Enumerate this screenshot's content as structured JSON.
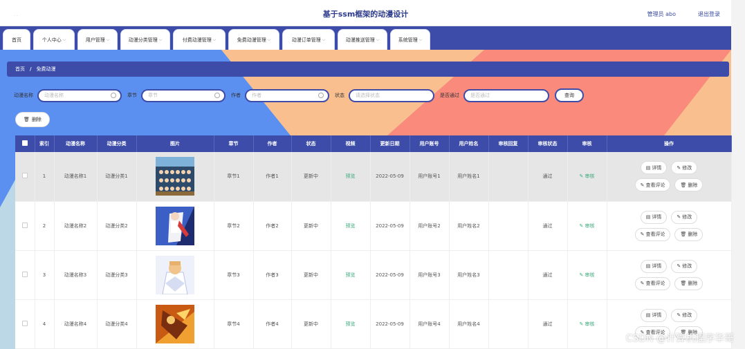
{
  "header": {
    "title": "基于ssm框架的动漫设计",
    "user": "管理员 abo",
    "logout": "退出登录"
  },
  "nav": [
    {
      "label": "首页",
      "chevron": false
    },
    {
      "label": "个人中心",
      "chevron": true
    },
    {
      "label": "用户管理",
      "chevron": true
    },
    {
      "label": "动漫分类管理",
      "chevron": true
    },
    {
      "label": "付费动漫管理",
      "chevron": true
    },
    {
      "label": "免费动漫管理",
      "chevron": true
    },
    {
      "label": "动漫订单管理",
      "chevron": true
    },
    {
      "label": "动漫推送管理",
      "chevron": true
    },
    {
      "label": "系统管理",
      "chevron": true
    }
  ],
  "breadcrumb": {
    "home": "首页",
    "current": "免费动漫"
  },
  "search": {
    "name_label": "动漫名称",
    "name_placeholder": "动漫名称",
    "chapter_label": "章节",
    "chapter_placeholder": "章节",
    "author_label": "作者",
    "author_placeholder": "作者",
    "status_label": "状态",
    "status_placeholder": "请选择状态",
    "approved_label": "是否通过",
    "approved_placeholder": "是否通过",
    "query_button": "查询"
  },
  "delete_button": "删除",
  "table": {
    "headers": [
      "",
      "索引",
      "动漫名称",
      "动漫分类",
      "图片",
      "章节",
      "作者",
      "状态",
      "视频",
      "更新日期",
      "用户账号",
      "用户姓名",
      "审核回复",
      "审核状态",
      "审核",
      "操作"
    ],
    "rows": [
      {
        "index": "1",
        "name": "动漫名称1",
        "category": "动漫分类1",
        "chapter": "章节1",
        "author": "作者1",
        "status": "更新中",
        "video": "预览",
        "date": "2022-05-09",
        "account": "用户账号1",
        "username": "用户姓名1",
        "reply": "",
        "audit_status": "通过",
        "audit": "审核"
      },
      {
        "index": "2",
        "name": "动漫名称2",
        "category": "动漫分类2",
        "chapter": "章节2",
        "author": "作者2",
        "status": "更新中",
        "video": "预览",
        "date": "2022-05-09",
        "account": "用户账号2",
        "username": "用户姓名2",
        "reply": "",
        "audit_status": "通过",
        "audit": "审核"
      },
      {
        "index": "3",
        "name": "动漫名称3",
        "category": "动漫分类3",
        "chapter": "章节3",
        "author": "作者3",
        "status": "更新中",
        "video": "预览",
        "date": "2022-05-09",
        "account": "用户账号3",
        "username": "用户姓名3",
        "reply": "",
        "audit_status": "通过",
        "audit": "审核"
      },
      {
        "index": "4",
        "name": "动漫名称4",
        "category": "动漫分类4",
        "chapter": "章节4",
        "author": "作者4",
        "status": "更新中",
        "video": "预览",
        "date": "2022-05-09",
        "account": "用户账号4",
        "username": "用户姓名4",
        "reply": "",
        "audit_status": "通过",
        "audit": "审核"
      }
    ],
    "actions": {
      "detail": "详情",
      "edit": "修改",
      "comments": "查看评论",
      "delete": "删除"
    }
  },
  "watermark": "CSDN @计算机程序华哥",
  "colors": {
    "primary": "#3c4ca8",
    "bg_blue": "#5b8ff0",
    "bg_peach": "#f9bf8e",
    "bg_coral": "#f98a7c",
    "bg_light": "#bcd7e6",
    "link_green": "#3aa97a"
  }
}
